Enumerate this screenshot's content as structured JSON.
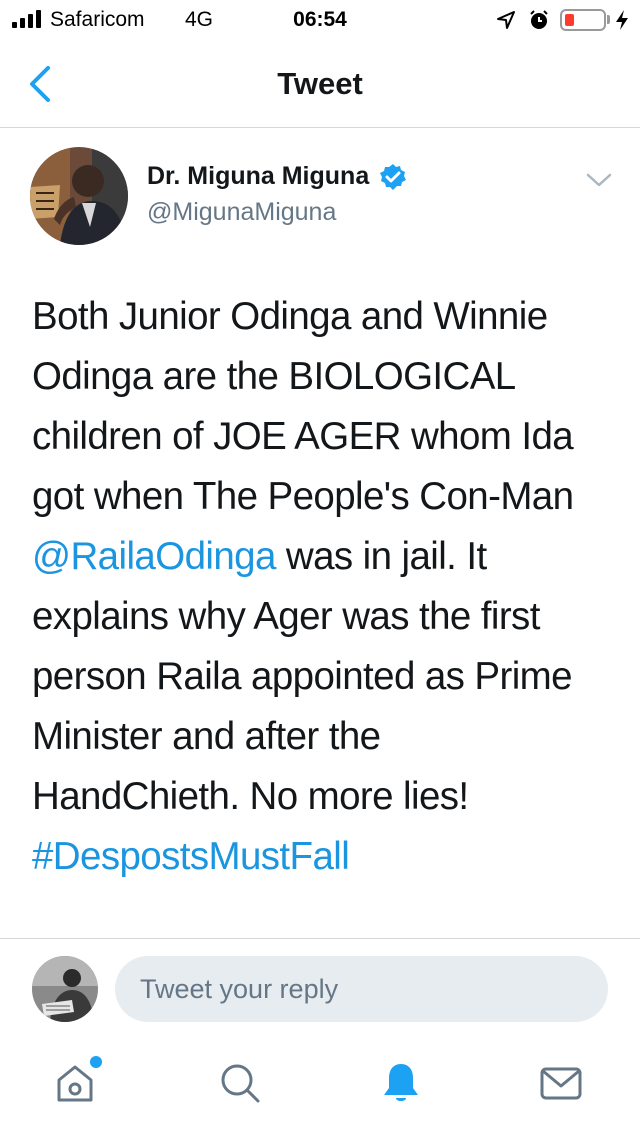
{
  "status_bar": {
    "carrier": "Safaricom",
    "network": "4G",
    "time": "06:54",
    "icons": [
      "signal-bars-icon",
      "location-arrow-icon",
      "alarm-clock-icon",
      "battery-low-icon",
      "charging-bolt-icon"
    ]
  },
  "nav": {
    "title": "Tweet",
    "back_icon": "back-chevron-icon"
  },
  "tweet": {
    "display_name": "Dr. Miguna Miguna",
    "handle": "@MigunaMiguna",
    "verified": true,
    "body_lines": [
      "Both Junior Odinga and Winnie",
      "Odinga are the BIOLOGICAL",
      "children of JOE AGER whom Ida",
      "got when The People's Con-Man"
    ],
    "mention": "@RailaOdinga",
    "line5_rest": " was in jail. It",
    "body_lines_2": [
      "explains why Ager was the first",
      "person Raila appointed as Prime",
      "Minister and after the",
      "HandChieth. No more lies!"
    ],
    "hashtag": "#DespostsMustFall"
  },
  "reply": {
    "placeholder": "Tweet your reply"
  },
  "tab_bar": {
    "tabs": [
      "home-icon",
      "search-icon",
      "notifications-bell-icon",
      "messages-envelope-icon"
    ],
    "active": "notifications-bell-icon"
  },
  "colors": {
    "accent": "#1da1f2",
    "link": "#1b95e0",
    "secondary_text": "#657786",
    "reply_bg": "#e6ecf0"
  }
}
